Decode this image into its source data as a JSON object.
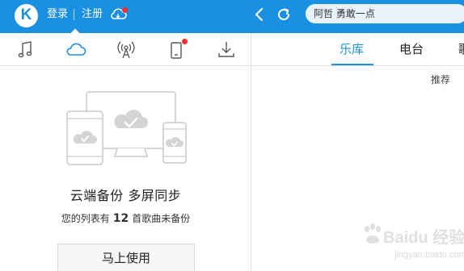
{
  "topbar": {
    "logo_letter": "K",
    "login_label": "登录",
    "register_label": "注册",
    "accent_color": "#1990e2",
    "notification_color": "#ff2d2d"
  },
  "search": {
    "value": "阿哲 勇敢一点"
  },
  "left_tabs": {
    "items": [
      "music-note-icon",
      "cloud-icon",
      "radio-broadcast-icon",
      "mobile-device-icon",
      "download-icon"
    ],
    "active_index": 1
  },
  "cloud_backup": {
    "title": "云端备份 多屏同步",
    "subtitle_prefix": "您的列表有",
    "unbacked_count": "12",
    "subtitle_suffix": "首歌曲未备份",
    "button_label": "马上使用"
  },
  "right_tabs": {
    "items": [
      "乐库",
      "电台",
      "歌"
    ],
    "active_index": 0
  },
  "recommend_label": "推荐",
  "watermark": {
    "text": "Baidu 经验",
    "url": "jingyan.baidu.com"
  }
}
